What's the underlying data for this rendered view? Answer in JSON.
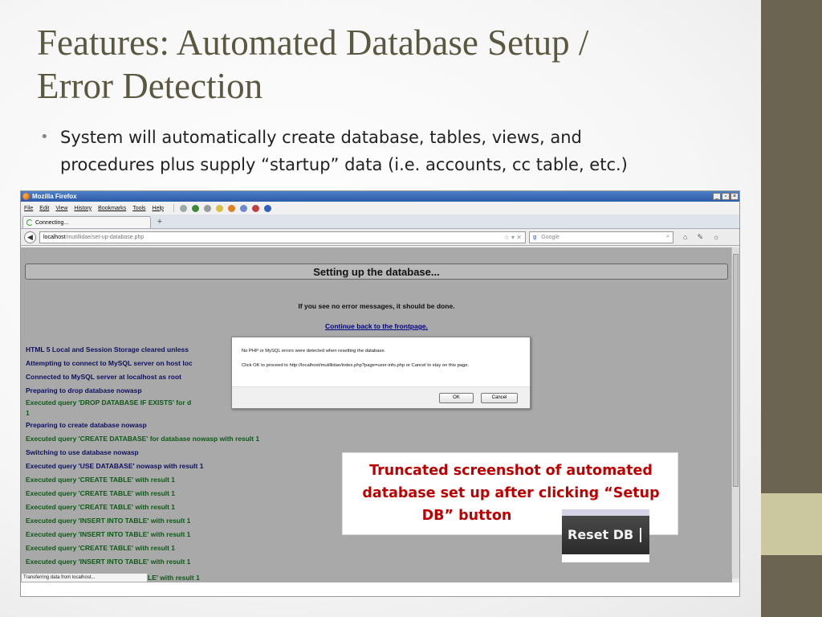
{
  "slide": {
    "title_lines": [
      "Features: Automated Database Setup /",
      "Error Detection"
    ],
    "bullet_lines": [
      "System will automatically create database, tables, views, and",
      "procedures plus supply “startup” data (i.e. accounts, cc table, etc.)"
    ],
    "accent_colors": {
      "sidebar": "#6b6450",
      "band": "#cbc79e",
      "title": "#5b5840"
    }
  },
  "browser": {
    "window_title": "Mozilla Firefox",
    "menu": [
      "File",
      "Edit",
      "View",
      "History",
      "Bookmarks",
      "Tools",
      "Help"
    ],
    "tab_label": "Connecting...",
    "new_tab": "+",
    "url_host": "localhost",
    "url_path": "/mutillidae/set-up-database.php",
    "search_engine": "Google",
    "status_text": "Transferring data from localhost..."
  },
  "page": {
    "header": "Setting up the database...",
    "no_errors_msg": "If you see no error messages, it should be done.",
    "continue_link": "Continue back to the frontpage.",
    "log": [
      {
        "text": "HTML 5 Local and Session Storage cleared unless",
        "color": "navy"
      },
      {
        "text": "Attempting to connect to MySQL server on host loc",
        "color": "navy"
      },
      {
        "text": "Connected to MySQL server at localhost as root",
        "color": "navy"
      },
      {
        "text": "Preparing to drop database nowasp",
        "color": "navy"
      },
      {
        "text": "Executed query 'DROP DATABASE IF EXISTS' for d",
        "color": "green"
      },
      {
        "text": "1",
        "color": "green"
      },
      {
        "text": "Preparing to create database nowasp",
        "color": "navy"
      },
      {
        "text": "Executed query 'CREATE DATABASE' for database nowasp with result 1",
        "color": "green"
      },
      {
        "text": "Switching to use database nowasp",
        "color": "navy"
      },
      {
        "text": "Executed query 'USE DATABASE' nowasp with result 1",
        "color": "navy"
      },
      {
        "text": "Executed query 'CREATE TABLE' with result 1",
        "color": "green"
      },
      {
        "text": "Executed query 'CREATE TABLE' with result 1",
        "color": "green"
      },
      {
        "text": "Executed query 'CREATE TABLE' with result 1",
        "color": "green"
      },
      {
        "text": "Executed query 'INSERT INTO TABLE' with result 1",
        "color": "green"
      },
      {
        "text": "Executed query 'INSERT INTO TABLE' with result 1",
        "color": "green"
      },
      {
        "text": "Executed query 'CREATE TABLE' with result 1",
        "color": "green"
      },
      {
        "text": "Executed query 'INSERT INTO TABLE' with result 1",
        "color": "green"
      }
    ],
    "status_continuation": "LE' with result 1"
  },
  "dialog": {
    "line1": "No PHP or MySQL errors were detected when resetting the database.",
    "line2": "Click OK to proceed to http://localhost/mutillidae/index.php?page=user-info.php or Cancel to stay on this page.",
    "ok": "OK",
    "cancel": "Cancel"
  },
  "callout": {
    "lines": [
      "Truncated screenshot of automated",
      "database set up after clicking “Setup",
      "DB” button"
    ],
    "color": "#c00000",
    "reset_button_label": "Reset DB"
  }
}
